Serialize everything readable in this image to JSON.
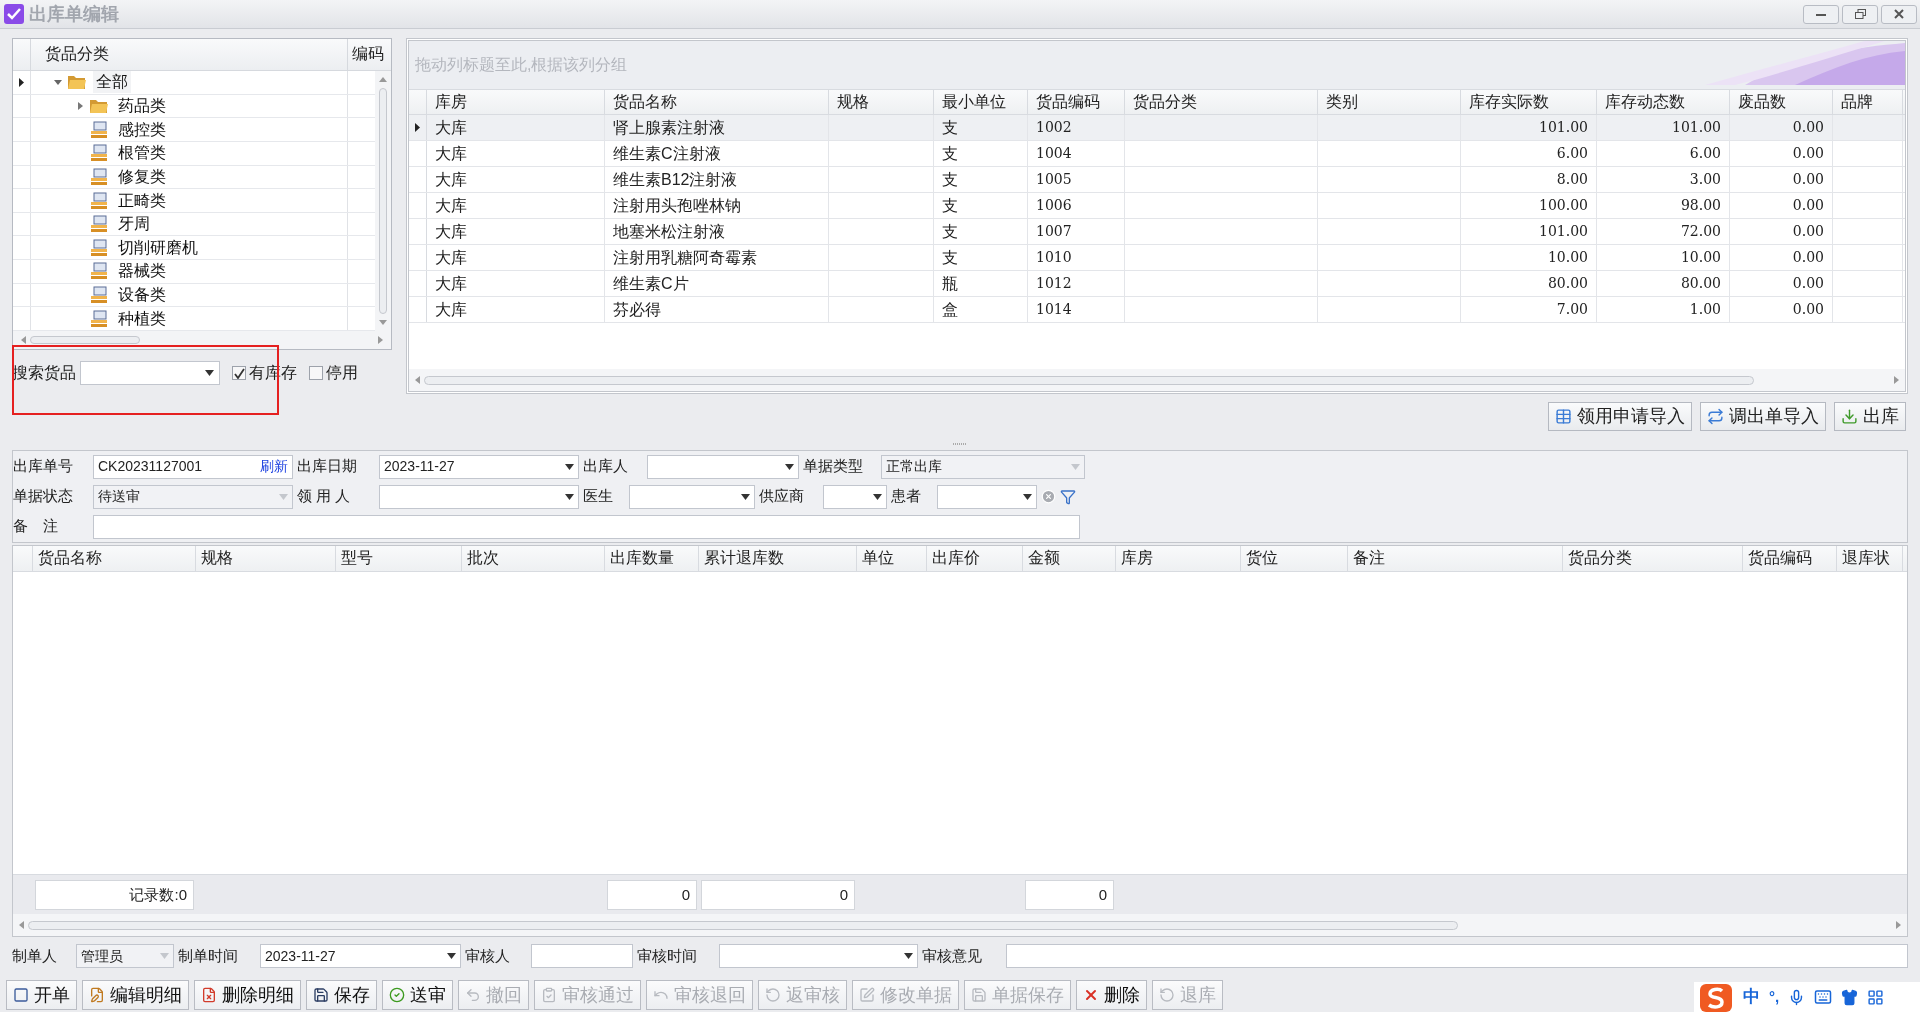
{
  "window": {
    "title": "出库单编辑"
  },
  "tree": {
    "columns": [
      "货品分类",
      "编码"
    ],
    "items": [
      {
        "label": "全部",
        "kind": "folder",
        "expanded": true,
        "selected": true,
        "children": [
          {
            "label": "药品类",
            "kind": "folder",
            "expanded": false,
            "selected": false
          },
          {
            "label": "感控类",
            "kind": "leaf",
            "selected": false
          },
          {
            "label": "根管类",
            "kind": "leaf",
            "selected": false
          },
          {
            "label": "修复类",
            "kind": "leaf",
            "selected": false
          },
          {
            "label": "正畸类",
            "kind": "leaf",
            "selected": false
          },
          {
            "label": "牙周",
            "kind": "leaf",
            "selected": false
          },
          {
            "label": "切削研磨机",
            "kind": "leaf",
            "selected": false
          },
          {
            "label": "器械类",
            "kind": "leaf",
            "selected": false
          },
          {
            "label": "设备类",
            "kind": "leaf",
            "selected": false
          },
          {
            "label": "种植类",
            "kind": "leaf",
            "selected": false
          }
        ]
      }
    ]
  },
  "search": {
    "label": "搜索货品",
    "checkboxes": [
      {
        "label": "有库存",
        "checked": true
      },
      {
        "label": "停用",
        "checked": false
      }
    ]
  },
  "stock_grid": {
    "group_hint": "拖动列标题至此,根据该列分组",
    "columns": [
      "库房",
      "货品名称",
      "规格",
      "最小单位",
      "货品编码",
      "货品分类",
      "类别",
      "库存实际数",
      "库存动态数",
      "废品数",
      "品牌"
    ],
    "rows": [
      {
        "selected": true,
        "cells": [
          "大库",
          "肾上腺素注射液",
          null,
          "支",
          "1002",
          null,
          null,
          "101.00",
          "101.00",
          "0.00",
          null
        ]
      },
      {
        "selected": false,
        "cells": [
          "大库",
          "维生素C注射液",
          null,
          "支",
          "1004",
          null,
          null,
          "6.00",
          "6.00",
          "0.00",
          null
        ]
      },
      {
        "selected": false,
        "cells": [
          "大库",
          "维生素B12注射液",
          null,
          "支",
          "1005",
          null,
          null,
          "8.00",
          "3.00",
          "0.00",
          null
        ]
      },
      {
        "selected": false,
        "cells": [
          "大库",
          "注射用头孢唑林钠",
          null,
          "支",
          "1006",
          null,
          null,
          "100.00",
          "98.00",
          "0.00",
          null
        ]
      },
      {
        "selected": false,
        "cells": [
          "大库",
          "地塞米松注射液",
          null,
          "支",
          "1007",
          null,
          null,
          "101.00",
          "72.00",
          "0.00",
          null
        ]
      },
      {
        "selected": false,
        "cells": [
          "大库",
          "注射用乳糖阿奇霉素",
          null,
          "支",
          "1010",
          null,
          null,
          "10.00",
          "10.00",
          "0.00",
          null
        ]
      },
      {
        "selected": false,
        "cells": [
          "大库",
          "维生素C片",
          null,
          "瓶",
          "1012",
          null,
          null,
          "80.00",
          "80.00",
          "0.00",
          null
        ]
      },
      {
        "selected": false,
        "cells": [
          "大库",
          "芬必得",
          null,
          "盒",
          "1014",
          null,
          null,
          "7.00",
          "1.00",
          "0.00",
          null
        ]
      }
    ]
  },
  "import_buttons": [
    {
      "label": "领用申请导入",
      "kind": "request"
    },
    {
      "label": "调出单导入",
      "kind": "transfer"
    },
    {
      "label": "出库",
      "kind": "out"
    }
  ],
  "form": {
    "fields": [
      {
        "label": "出库单号",
        "kind": "text",
        "value": "CK20231127001",
        "link": "刷新",
        "disabled": false
      },
      {
        "label": "出库日期",
        "kind": "combo",
        "value": "2023-11-27",
        "disabled": false
      },
      {
        "label": "出库人",
        "kind": "combo",
        "disabled": false
      },
      {
        "label": "单据类型",
        "kind": "combo",
        "value": "正常出库",
        "disabled": true
      },
      {
        "label": "单据状态",
        "kind": "combo",
        "value": "待送审",
        "disabled": true
      },
      {
        "label": "领 用 人",
        "kind": "combo",
        "disabled": false
      },
      {
        "label": "医生",
        "kind": "combo",
        "disabled": false
      },
      {
        "label": "供应商",
        "kind": "combo",
        "disabled": false
      },
      {
        "label": "患者",
        "kind": "combo",
        "disabled": false,
        "clearable": true
      },
      {
        "label": "备　注",
        "kind": "text",
        "disabled": false
      }
    ]
  },
  "detail_grid": {
    "columns": [
      {
        "label": "货品名称",
        "total": "记录数:0"
      },
      {
        "label": "规格"
      },
      {
        "label": "型号"
      },
      {
        "label": "批次"
      },
      {
        "label": "出库数量",
        "total": "0"
      },
      {
        "label": "累计退库数",
        "total": "0"
      },
      {
        "label": "单位"
      },
      {
        "label": "出库价"
      },
      {
        "label": "金额",
        "total": "0"
      },
      {
        "label": "库房"
      },
      {
        "label": "货位"
      },
      {
        "label": "备注"
      },
      {
        "label": "货品分类"
      },
      {
        "label": "货品编码"
      },
      {
        "label": "退库状"
      }
    ]
  },
  "audit": [
    {
      "label": "制单人",
      "kind": "combo",
      "value": "管理员",
      "disabled": true
    },
    {
      "label": "制单时间",
      "kind": "combo",
      "value": "2023-11-27",
      "disabled": false
    },
    {
      "label": "审核人",
      "kind": "text",
      "disabled": false
    },
    {
      "label": "审核时间",
      "kind": "combo",
      "disabled": false
    },
    {
      "label": "审核意见",
      "kind": "text",
      "disabled": false
    }
  ],
  "toolbar": [
    {
      "label": "开单",
      "kind": "new",
      "disabled": false
    },
    {
      "label": "编辑明细",
      "kind": "edit",
      "disabled": false
    },
    {
      "label": "删除明细",
      "kind": "remove",
      "disabled": false
    },
    {
      "label": "保存",
      "kind": "save",
      "disabled": false
    },
    {
      "label": "送审",
      "kind": "submit",
      "disabled": false
    },
    {
      "label": "撤回",
      "kind": "back",
      "disabled": true
    },
    {
      "label": "审核通过",
      "kind": "approve",
      "disabled": true
    },
    {
      "label": "审核退回",
      "kind": "return",
      "disabled": true
    },
    {
      "label": "返审核",
      "kind": "reaudit",
      "disabled": true
    },
    {
      "label": "修改单据",
      "kind": "modify",
      "disabled": true
    },
    {
      "label": "单据保存",
      "kind": "save",
      "disabled": true
    },
    {
      "label": "删除",
      "kind": "delete",
      "disabled": false
    },
    {
      "label": "退库",
      "kind": "reaudit",
      "disabled": true
    }
  ],
  "ime": {
    "mode": "中",
    "punctuation": "°,"
  }
}
